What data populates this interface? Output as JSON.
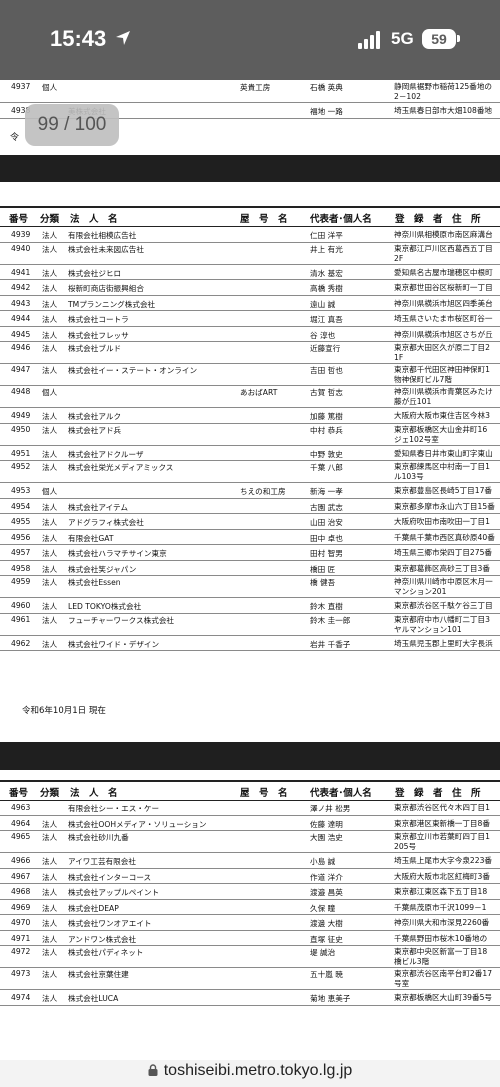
{
  "status_bar": {
    "time": "15:43",
    "network": "5G",
    "battery": "59"
  },
  "page_indicator": "99 / 100",
  "url": "toshiseibi.metro.tokyo.lg.jp",
  "headers": {
    "no": "番号",
    "cls": "分類",
    "corp": "法　人　名",
    "yago": "屋　号　名",
    "rep": "代表者･個人名",
    "addr": "登　録　者　住　所"
  },
  "date_note": "令和6年10月1日 現在",
  "top_rows": [
    {
      "no": "4937",
      "cls": "個人",
      "corp": "",
      "yago": "英貴工房",
      "rep": "石橋 英典",
      "addr": "静岡県裾野市稲荷125番地の\n2－102"
    },
    {
      "no": "4938",
      "cls": "",
      "corp": "美株式会社",
      "yago": "",
      "rep": "福地 一路",
      "addr": "埼玉県春日部市大畑108番地"
    }
  ],
  "mid_rows": [
    {
      "no": "4939",
      "cls": "法人",
      "corp": "有限会社相模広告社",
      "yago": "",
      "rep": "仁田 洋平",
      "addr": "神奈川県相模原市南区麻溝台"
    },
    {
      "no": "4940",
      "cls": "法人",
      "corp": "株式会社未来図広告社",
      "yago": "",
      "rep": "井上 有光",
      "addr": "東京都江戸川区西葛西五丁目\n2F"
    },
    {
      "no": "4941",
      "cls": "法人",
      "corp": "株式会社ジヒロ",
      "yago": "",
      "rep": "清水 基宏",
      "addr": "愛知県名古屋市瑞穂区中根町"
    },
    {
      "no": "4942",
      "cls": "法人",
      "corp": "桜新町商店街振興組合",
      "yago": "",
      "rep": "高橋 秀樹",
      "addr": "東京都世田谷区桜新町一丁目"
    },
    {
      "no": "4943",
      "cls": "法人",
      "corp": "TMプランニング株式会社",
      "yago": "",
      "rep": "遠山 誠",
      "addr": "神奈川県横浜市旭区四季美台"
    },
    {
      "no": "4944",
      "cls": "法人",
      "corp": "株式会社コートラ",
      "yago": "",
      "rep": "堀江 真吾",
      "addr": "埼玉県さいたま市桜区町谷一"
    },
    {
      "no": "4945",
      "cls": "法人",
      "corp": "株式会社フレッサ",
      "yago": "",
      "rep": "谷 淳也",
      "addr": "神奈川県横浜市旭区さちが丘"
    },
    {
      "no": "4946",
      "cls": "法人",
      "corp": "株式会社ブルド",
      "yago": "",
      "rep": "近藤宣行",
      "addr": "東京都大田区久が原二丁目2\n1F"
    },
    {
      "no": "4947",
      "cls": "法人",
      "corp": "株式会社イー・ステート・オンライン",
      "yago": "",
      "rep": "吉田 哲也",
      "addr": "東京都千代田区神田神保町1\n物神保町ビル7階"
    },
    {
      "no": "4948",
      "cls": "個人",
      "corp": "",
      "yago": "あおばART",
      "rep": "古賀 哲志",
      "addr": "神奈川県横浜市青葉区みたけ\n藤が丘101"
    },
    {
      "no": "4949",
      "cls": "法人",
      "corp": "株式会社アルク",
      "yago": "",
      "rep": "加藤 篤樹",
      "addr": "大阪府大阪市東住吉区今林3"
    },
    {
      "no": "4950",
      "cls": "法人",
      "corp": "株式会社アド兵",
      "yago": "",
      "rep": "中村 恭兵",
      "addr": "東京都板橋区大山金井町16\nジェ102号室"
    },
    {
      "no": "4951",
      "cls": "法人",
      "corp": "株式会社アドクルーザ",
      "yago": "",
      "rep": "中野 敦史",
      "addr": "愛知県春日井市東山町字東山"
    },
    {
      "no": "4952",
      "cls": "法人",
      "corp": "株式会社栄光メディアミックス",
      "yago": "",
      "rep": "千葉 八郎",
      "addr": "東京都練馬区中村南一丁目1\nル103号"
    },
    {
      "no": "4953",
      "cls": "個人",
      "corp": "",
      "yago": "ちえの和工房",
      "rep": "新海 一孝",
      "addr": "東京都豊島区長崎5丁目17番"
    },
    {
      "no": "4954",
      "cls": "法人",
      "corp": "株式会社アイテム",
      "yago": "",
      "rep": "古園 武志",
      "addr": "東京都多摩市永山六丁目15番"
    },
    {
      "no": "4955",
      "cls": "法人",
      "corp": "アドグラフィ株式会社",
      "yago": "",
      "rep": "山田 治安",
      "addr": "大阪府吹田市南吹田一丁目1"
    },
    {
      "no": "4956",
      "cls": "法人",
      "corp": "有限会社GAT",
      "yago": "",
      "rep": "田中 卓也",
      "addr": "千葉県千葉市西区真砂原40番"
    },
    {
      "no": "4957",
      "cls": "法人",
      "corp": "株式会社ハラマチサイン東京",
      "yago": "",
      "rep": "田村 智男",
      "addr": "埼玉県三郷市栄四丁目275番"
    },
    {
      "no": "4958",
      "cls": "法人",
      "corp": "株式会社笑ジャパン",
      "yago": "",
      "rep": "橋田 匠",
      "addr": "東京都葛飾区高砂三丁目3番"
    },
    {
      "no": "4959",
      "cls": "法人",
      "corp": "株式会社Essen",
      "yago": "",
      "rep": "橋 健吾",
      "addr": "神奈川県川崎市中原区木月一\nマンション201"
    },
    {
      "no": "4960",
      "cls": "法人",
      "corp": "LED TOKYO株式会社",
      "yago": "",
      "rep": "鈴木 直樹",
      "addr": "東京都渋谷区千駄ケ谷三丁目"
    },
    {
      "no": "4961",
      "cls": "法人",
      "corp": "フューチャーワークス株式会社",
      "yago": "",
      "rep": "鈴木 圭一郎",
      "addr": "東京都府中市八幡町二丁目3\nヤルマンション101"
    },
    {
      "no": "4962",
      "cls": "法人",
      "corp": "株式会社ワイド・デザイン",
      "yago": "",
      "rep": "岩井 千香子",
      "addr": "埼玉県児玉郡上里町大字長浜"
    }
  ],
  "bot_rows": [
    {
      "no": "4963",
      "cls": "",
      "corp": "有限会社シー・エス・ケー",
      "yago": "",
      "rep": "澤ノ井 松男",
      "addr": "東京都渋谷区代々木四丁目1"
    },
    {
      "no": "4964",
      "cls": "法人",
      "corp": "株式会社OOHメディア・ソリューション",
      "yago": "",
      "rep": "佐藤 達明",
      "addr": "東京都港区東新橋一丁目8番"
    },
    {
      "no": "4965",
      "cls": "法人",
      "corp": "株式会社砂川九番",
      "yago": "",
      "rep": "大園 浩史",
      "addr": "東京都立川市若葉町四丁目1\n205号"
    },
    {
      "no": "4966",
      "cls": "法人",
      "corp": "アイワ工芸有限会社",
      "yago": "",
      "rep": "小島 誠",
      "addr": "埼玉県上尾市大字今泉223番"
    },
    {
      "no": "4967",
      "cls": "法人",
      "corp": "株式会社インターコース",
      "yago": "",
      "rep": "作道 洋介",
      "addr": "大阪府大阪市北区紅梅町3番"
    },
    {
      "no": "4968",
      "cls": "法人",
      "corp": "株式会社アップルペイント",
      "yago": "",
      "rep": "渡邉 昌英",
      "addr": "東京都江東区森下五丁目18"
    },
    {
      "no": "4969",
      "cls": "法人",
      "corp": "株式会社DEAP",
      "yago": "",
      "rep": "久保 瞳",
      "addr": "千葉県茂原市千沢1099－1"
    },
    {
      "no": "4970",
      "cls": "法人",
      "corp": "株式会社ワンオアエイト",
      "yago": "",
      "rep": "渡邊 大樹",
      "addr": "神奈川県大和市深見2260番"
    },
    {
      "no": "4971",
      "cls": "法人",
      "corp": "アンドワン株式会社",
      "yago": "",
      "rep": "直塚 征史",
      "addr": "千葉県野田市桜木10番地の"
    },
    {
      "no": "4972",
      "cls": "法人",
      "corp": "株式会社パディネット",
      "yago": "",
      "rep": "堤 誠治",
      "addr": "東京都中央区新富一丁目18\n橋ビル3階"
    },
    {
      "no": "4973",
      "cls": "法人",
      "corp": "株式会社京葉住建",
      "yago": "",
      "rep": "五十嵐 暁",
      "addr": "東京都渋谷区南平台町2番17\n号室"
    },
    {
      "no": "4974",
      "cls": "法人",
      "corp": "株式会社LUCA",
      "yago": "",
      "rep": "菊地 恵美子",
      "addr": "東京都板橋区大山町39番5号"
    }
  ]
}
